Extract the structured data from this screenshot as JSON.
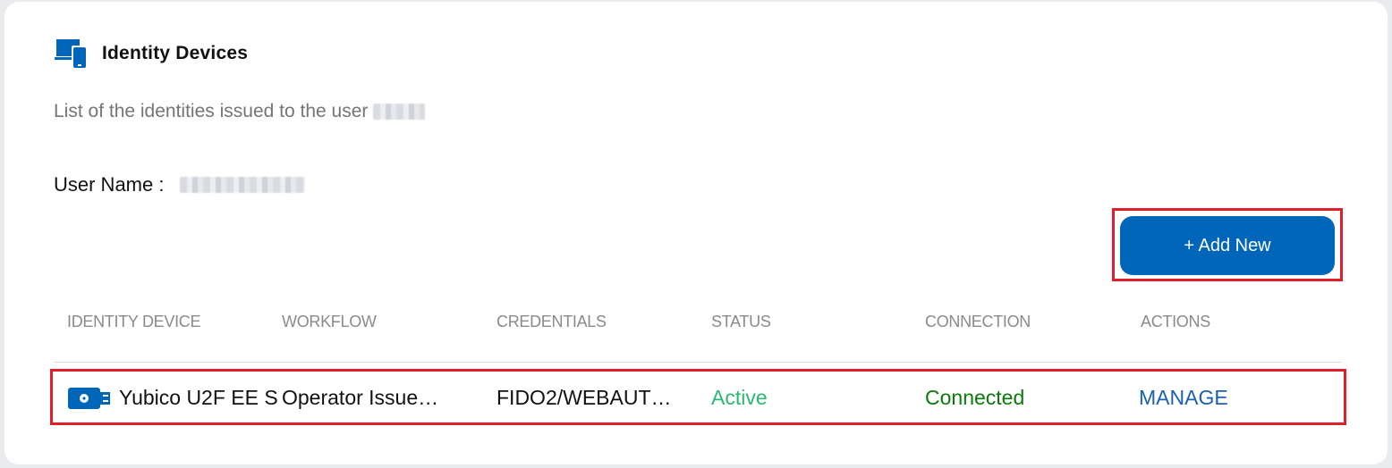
{
  "header": {
    "title": "Identity Devices",
    "icon": "devices-icon"
  },
  "subtitle": {
    "text": "List of the identities issued to the user",
    "redacted_first_name": "[redacted]"
  },
  "user": {
    "label": "User Name :",
    "redacted_full_name": "[redacted]"
  },
  "toolbar": {
    "add_new_label": "+ Add New"
  },
  "table": {
    "columns": [
      "IDENTITY DEVICE",
      "WORKFLOW",
      "CREDENTIALS",
      "STATUS",
      "CONNECTION",
      "ACTIONS"
    ],
    "rows": [
      {
        "device_icon": "usb-security-key-icon",
        "device": "Yubico U2F EE S",
        "workflow": "Operator Issue…",
        "credentials": "FIDO2/WEBAUT…",
        "status": "Active",
        "connection": "Connected",
        "action": "MANAGE"
      }
    ]
  },
  "colors": {
    "brand_blue": "#0066b9",
    "status_active": "#2cb872",
    "connection_connected": "#0b7a0b",
    "action_link": "#1a5fb4",
    "highlight_red": "#e31e2b"
  }
}
